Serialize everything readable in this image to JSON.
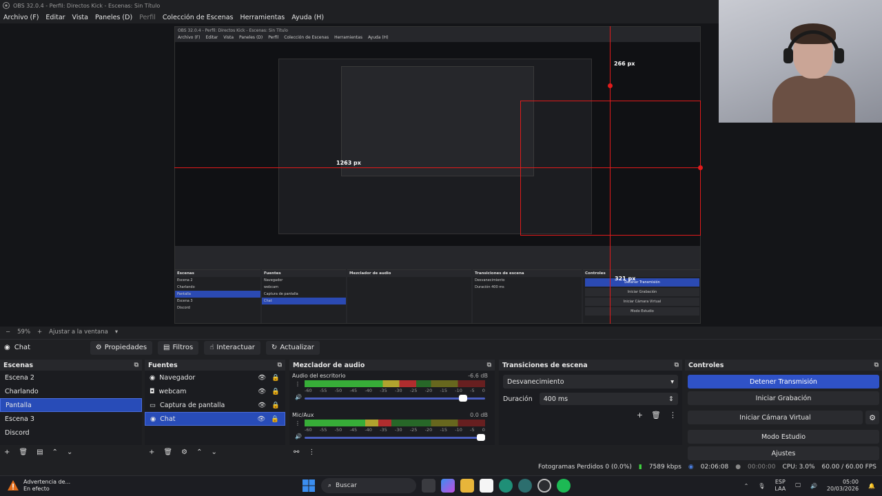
{
  "window": {
    "title": "OBS 32.0.4 - Perfil: Directos Kick - Escenas: Sin Título"
  },
  "menu": {
    "items": [
      "Archivo (F)",
      "Editar",
      "Vista",
      "Paneles (D)",
      "Perfil",
      "Colección de Escenas",
      "Herramientas",
      "Ayuda (H)"
    ]
  },
  "preview": {
    "nested_title": "OBS 32.0.4 - Perfil: Directos Kick - Escenas: Sin Título",
    "nested_menu": [
      "Archivo (F)",
      "Editar",
      "Vista",
      "Paneles (D)",
      "Perfil",
      "Colección de Escenas",
      "Herramientas",
      "Ayuda (H)"
    ],
    "measure_labels": [
      "266 px",
      "266 px",
      "1263 px",
      "1263 px",
      "321 px",
      "321 px"
    ],
    "nested_scenes": [
      "Escena 2",
      "Charlando",
      "Pantalla",
      "Escena 3",
      "Discord"
    ],
    "nested_sources": [
      "Navegador",
      "webcam",
      "Captura de pantalla",
      "Chat"
    ],
    "nested_controls": [
      "Detener Transmisión",
      "Iniciar Grabación",
      "Iniciar Cámara Virtual",
      "Modo Estudio",
      "Ajustes"
    ],
    "nested_status": "Fotogramas Perdidos 0 (0.0%)   7589 kbps   02:06:08   00:00:00   CPU: 3.0%   60.00 / 60.00 FPS",
    "nested_zoom": "59%",
    "nested_fit": "Ajustar a la ventana",
    "nested_source_name": "Chat",
    "nested_toolbar": [
      "Propiedades",
      "Filtros",
      "Interactuar",
      "Actualizar"
    ],
    "nested_headers": [
      "Escenas",
      "Fuentes",
      "Mezclador de audio",
      "Transiciones de escena",
      "Controles"
    ],
    "nested_transition": "Desvanecimiento",
    "nested_duration_label": "Duración",
    "nested_duration_value": "400 ms"
  },
  "zoom": {
    "minus": "−",
    "value": "59%",
    "plus": "+",
    "fit_label": "Ajustar a la ventana"
  },
  "source_toolbar": {
    "current_source": "Chat",
    "properties": "Propiedades",
    "filters": "Filtros",
    "interact": "Interactuar",
    "refresh": "Actualizar"
  },
  "scenes": {
    "title": "Escenas",
    "items": [
      "Escena 2",
      "Charlando",
      "Pantalla",
      "Escena 3",
      "Discord"
    ],
    "selected": "Pantalla"
  },
  "sources": {
    "title": "Fuentes",
    "items": [
      {
        "name": "Navegador",
        "icon": "globe-icon"
      },
      {
        "name": "webcam",
        "icon": "camera-icon"
      },
      {
        "name": "Captura de pantalla",
        "icon": "monitor-icon"
      },
      {
        "name": "Chat",
        "icon": "globe-icon"
      }
    ],
    "selected": "Chat"
  },
  "mixer": {
    "title": "Mezclador de audio",
    "channels": [
      {
        "name": "Audio del escritorio",
        "db": "-6.6 dB",
        "level": 0.62,
        "volume": 0.9
      },
      {
        "name": "Mic/Aux",
        "db": "0.0 dB",
        "level": 0.48,
        "volume": 1.0
      }
    ],
    "ticks": [
      "-60",
      "-55",
      "-50",
      "-45",
      "-40",
      "-35",
      "-30",
      "-25",
      "-20",
      "-15",
      "-10",
      "-5",
      "0"
    ]
  },
  "transitions": {
    "title": "Transiciones de escena",
    "selected": "Desvanecimiento",
    "duration_label": "Duración",
    "duration_value": "400 ms"
  },
  "controls": {
    "title": "Controles",
    "stop_stream": "Detener Transmisión",
    "start_recording": "Iniciar Grabación",
    "start_virtual_cam": "Iniciar Cámara Virtual",
    "studio_mode": "Modo Estudio",
    "settings": "Ajustes"
  },
  "status": {
    "dropped_frames": "Fotogramas Perdidos 0 (0.0%)",
    "bitrate": "7589 kbps",
    "stream_time": "02:06:08",
    "record_time": "00:00:00",
    "cpu": "CPU: 3.0%",
    "fps": "60.00 / 60.00 FPS"
  },
  "taskbar": {
    "warning_title": "Advertencia de...",
    "warning_sub": "En efecto",
    "search": "Buscar",
    "lang": "ESP",
    "lang2": "LAA",
    "time": "05:00",
    "date": "20/03/2026"
  },
  "colors": {
    "accent": "#2f52c7",
    "measure_red": "#e21b1b"
  }
}
